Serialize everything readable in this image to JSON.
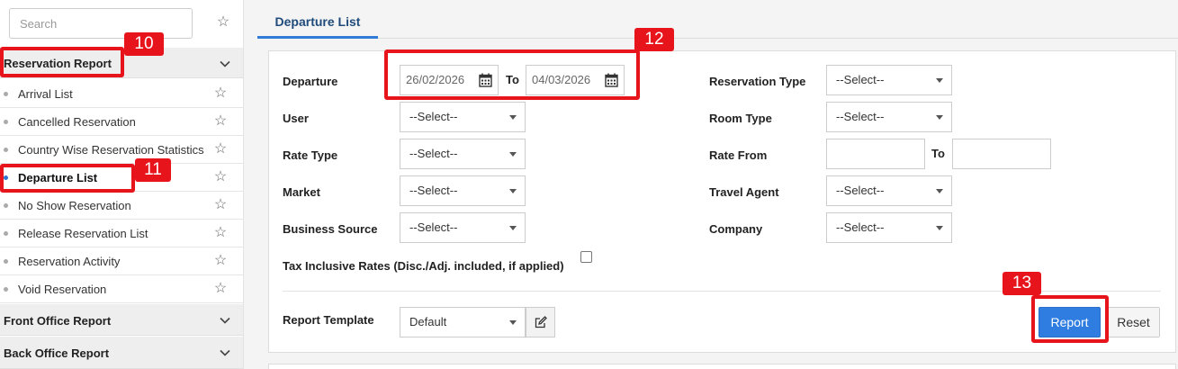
{
  "sidebar": {
    "search_placeholder": "Search",
    "section_reservation": "Reservation Report",
    "items": [
      {
        "label": "Arrival List"
      },
      {
        "label": "Cancelled Reservation"
      },
      {
        "label": "Country Wise Reservation Statistics"
      },
      {
        "label": "Departure List"
      },
      {
        "label": "No Show Reservation"
      },
      {
        "label": "Release Reservation List"
      },
      {
        "label": "Reservation Activity"
      },
      {
        "label": "Void Reservation"
      }
    ],
    "section_front": "Front Office Report",
    "section_back": "Back Office Report"
  },
  "tab": {
    "label": "Departure List"
  },
  "form": {
    "departure_label": "Departure",
    "departure_from": "26/02/2026",
    "to_label": "To",
    "departure_to": "04/03/2026",
    "user_label": "User",
    "user_value": "--Select--",
    "rate_type_label": "Rate Type",
    "rate_type_value": "--Select--",
    "market_label": "Market",
    "market_value": "--Select--",
    "business_source_label": "Business Source",
    "business_source_value": "--Select--",
    "tax_label": "Tax Inclusive Rates (Disc./Adj. included, if applied)",
    "reservation_type_label": "Reservation Type",
    "reservation_type_value": "--Select--",
    "room_type_label": "Room Type",
    "room_type_value": "--Select--",
    "rate_from_label": "Rate From",
    "rate_to_label": "To",
    "travel_agent_label": "Travel Agent",
    "travel_agent_value": "--Select--",
    "company_label": "Company",
    "company_value": "--Select--",
    "report_template_label": "Report Template",
    "report_template_value": "Default",
    "report_button": "Report",
    "reset_button": "Reset"
  },
  "annotations": {
    "badge_10": "10",
    "badge_11": "11",
    "badge_12": "12",
    "badge_13": "13",
    "color": "#e8141c"
  },
  "colors": {
    "accent": "#2f7de1",
    "active_dot": "#2f74d0"
  }
}
